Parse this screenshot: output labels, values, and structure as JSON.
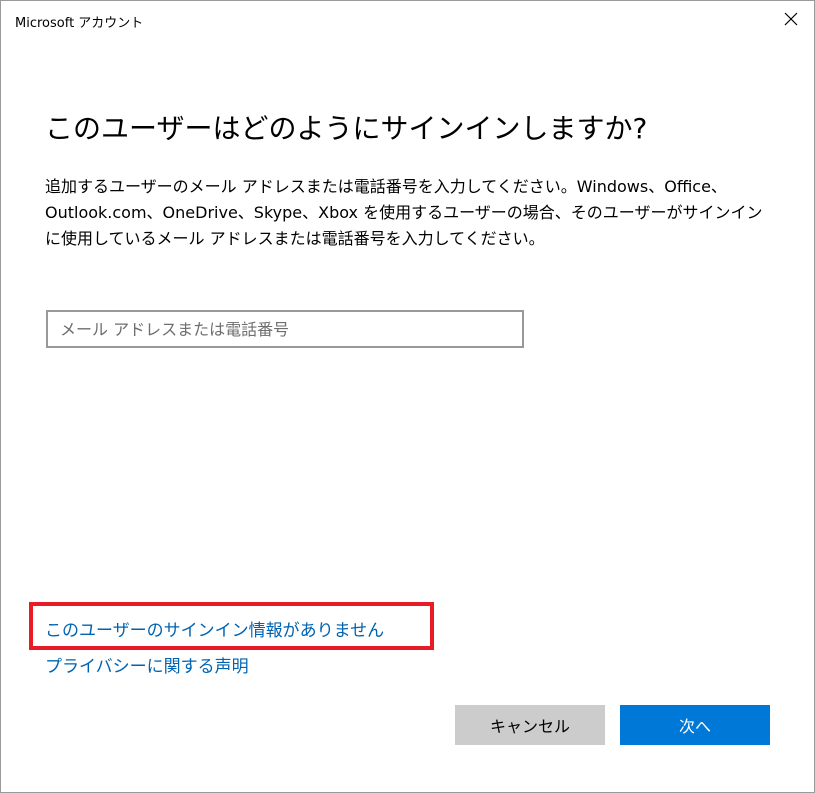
{
  "window": {
    "title": "Microsoft アカウント"
  },
  "main": {
    "heading": "このユーザーはどのようにサインインしますか?",
    "description": "追加するユーザーのメール アドレスまたは電話番号を入力してください。Windows、Office、Outlook.com、OneDrive、Skype、Xbox を使用するユーザーの場合、そのユーザーがサインインに使用しているメール アドレスまたは電話番号を入力してください。",
    "email_placeholder": "メール アドレスまたは電話番号",
    "email_value": ""
  },
  "links": {
    "no_signin_info": "このユーザーのサインイン情報がありません",
    "privacy": "プライバシーに関する声明"
  },
  "buttons": {
    "cancel": "キャンセル",
    "next": "次へ"
  },
  "icons": {
    "close": "close-icon"
  },
  "colors": {
    "link": "#0063b1",
    "primary_button": "#0078d7",
    "secondary_button": "#cccccc",
    "highlight": "#e81c27"
  }
}
